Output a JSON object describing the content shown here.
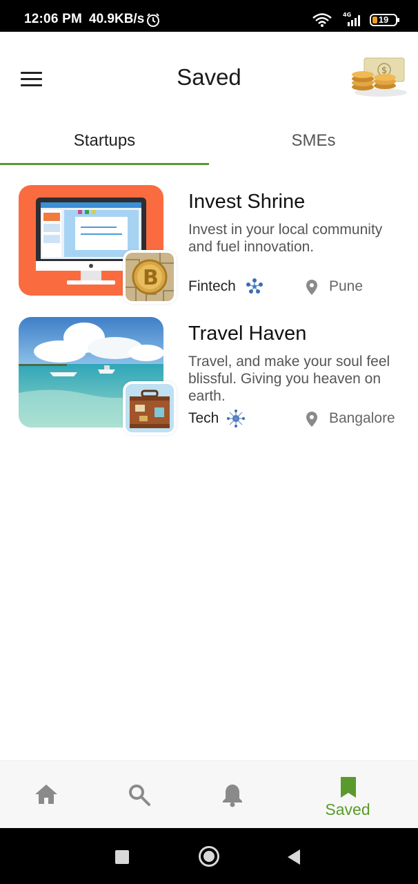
{
  "status_bar": {
    "time": "12:06 PM",
    "net_speed": "40.9KB/s",
    "network": "4G",
    "battery": "19",
    "battery_level_percent": 19
  },
  "app_bar": {
    "title": "Saved",
    "menu_icon": "hamburger-menu-icon",
    "logo_icon": "coins-money-icon"
  },
  "tabs": [
    {
      "label": "Startups",
      "active": true
    },
    {
      "label": "SMEs",
      "active": false
    }
  ],
  "items": [
    {
      "name": "Invest Shrine",
      "description": "Invest in your local community and fuel innovation.",
      "category": "Fintech",
      "category_icon": "fintech-network-icon",
      "location": "Pune",
      "thumb_icon": "computer-monitor-image",
      "badge_icon": "bitcoin-coin-image"
    },
    {
      "name": "Travel Haven",
      "description": "Travel, and make your soul feel blissful. Giving you heaven on earth.",
      "category": "Tech",
      "category_icon": "tech-node-icon",
      "location": "Bangalore",
      "thumb_icon": "sea-boats-photo",
      "badge_icon": "suitcase-image"
    }
  ],
  "bottom_nav": [
    {
      "icon": "home-icon",
      "label": ""
    },
    {
      "icon": "search-icon",
      "label": ""
    },
    {
      "icon": "bell-icon",
      "label": ""
    },
    {
      "icon": "bookmark-icon",
      "label": "Saved",
      "active": true
    }
  ],
  "colors": {
    "accent": "#5a9a2c",
    "inactive_icon": "#8a8a8a",
    "thumb_orange": "#fa6b3f"
  }
}
